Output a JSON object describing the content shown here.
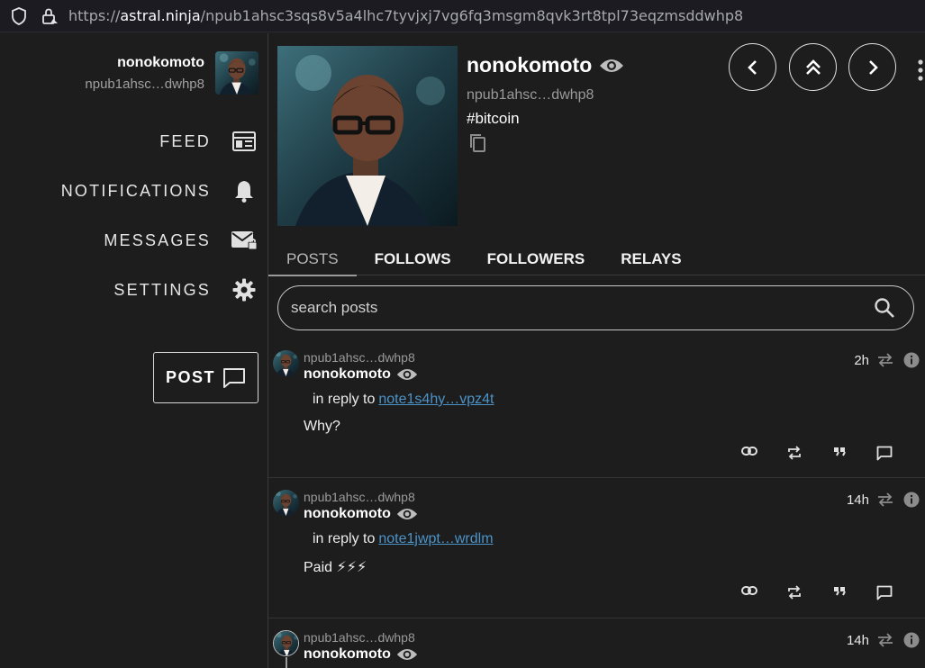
{
  "browser": {
    "url_scheme": "https://",
    "url_host": "astral.ninja",
    "url_path": "/npub1ahsc3sqs8v5a4lhc7tyvjxj7vg6fq3msgm8qvk3rt8tpl73eqzmsddwhp8"
  },
  "sidebar": {
    "user_name": "nonokomoto",
    "user_npub": "npub1ahsc…dwhp8",
    "nav": [
      {
        "label": "FEED",
        "icon": "feed-icon"
      },
      {
        "label": "NOTIFICATIONS",
        "icon": "bell-icon"
      },
      {
        "label": "MESSAGES",
        "icon": "mail-lock-icon"
      },
      {
        "label": "SETTINGS",
        "icon": "gear-icon"
      }
    ],
    "post_button": "POST"
  },
  "profile": {
    "name": "nonokomoto",
    "npub": "npub1ahsc…dwhp8",
    "about": "#bitcoin"
  },
  "tabs": [
    "POSTS",
    "FOLLOWS",
    "FOLLOWERS",
    "RELAYS"
  ],
  "search": {
    "placeholder": "search posts"
  },
  "posts": [
    {
      "npub": "npub1ahsc…dwhp8",
      "name": "nonokomoto",
      "reply_prefix": "in reply to",
      "reply_link": "note1s4hy…vpz4t",
      "content": "Why?",
      "time": "2h"
    },
    {
      "npub": "npub1ahsc…dwhp8",
      "name": "nonokomoto",
      "reply_prefix": "in reply to",
      "reply_link": "note1jwpt…wrdlm",
      "content": "Paid ⚡⚡⚡",
      "time": "14h"
    },
    {
      "npub": "npub1ahsc…dwhp8",
      "name": "nonokomoto",
      "time": "14h"
    }
  ],
  "colors": {
    "background": "#1d1d1d",
    "link": "#4c93c8",
    "muted": "#9a9a9a"
  }
}
